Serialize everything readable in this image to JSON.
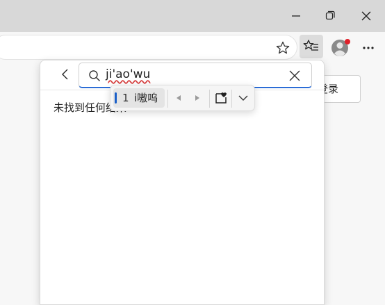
{
  "window": {
    "minimize_icon": "minimize-icon",
    "maximize_icon": "restore-icon",
    "close_icon": "close-icon"
  },
  "toolbar": {
    "favorite_icon": "star-icon",
    "favorites_hub_icon": "favorites-list-icon",
    "profile_icon": "avatar-icon",
    "more_icon": "more-icon",
    "profile_badge_color": "#e0202a"
  },
  "page": {
    "login_label": "登录"
  },
  "favorites_panel": {
    "back_icon": "chevron-left-icon",
    "search_query": "ji'ao'wu",
    "no_result_text": "未找到任何结果"
  },
  "ime": {
    "candidate_index": "1",
    "candidate_text": "i嗷呜",
    "prev_icon": "triangle-left-icon",
    "next_icon": "triangle-right-icon",
    "emoji_icon": "emoji-heart-icon",
    "expand_icon": "chevron-down-icon"
  }
}
